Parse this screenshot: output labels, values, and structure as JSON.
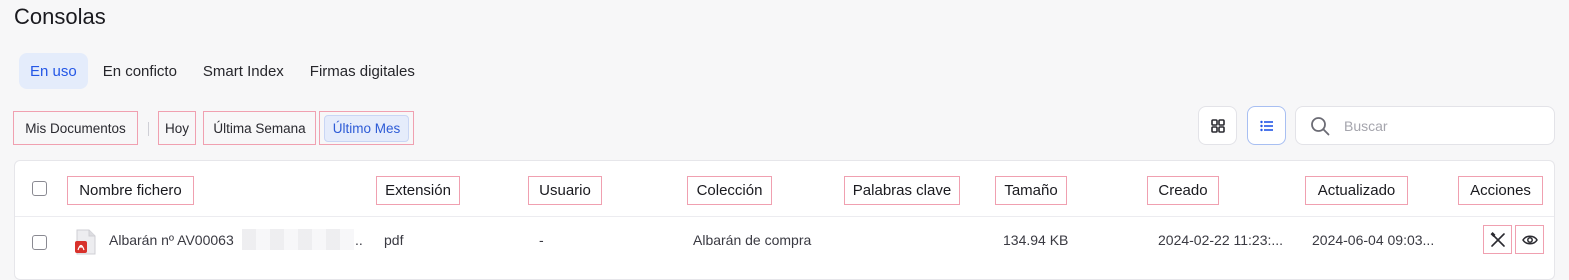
{
  "page": {
    "title": "Consolas"
  },
  "tabs": [
    {
      "label": "En uso",
      "active": true
    },
    {
      "label": "En conficto",
      "active": false
    },
    {
      "label": "Smart Index",
      "active": false
    },
    {
      "label": "Firmas digitales",
      "active": false
    }
  ],
  "filters": [
    {
      "label": "Mis Documentos",
      "selected": false
    },
    {
      "label": "Hoy",
      "selected": false
    },
    {
      "label": "Última Semana",
      "selected": false
    },
    {
      "label": "Último Mes",
      "selected": true
    }
  ],
  "search": {
    "placeholder": "Buscar",
    "value": ""
  },
  "view_buttons": {
    "grid_icon": "grid-icon",
    "list_icon": "list-icon",
    "active": "list"
  },
  "table": {
    "columns": [
      "Nombre fichero",
      "Extensión",
      "Usuario",
      "Colección",
      "Palabras clave",
      "Tamaño",
      "Creado",
      "Actualizado",
      "Acciones"
    ],
    "rows": [
      {
        "name": "Albarán nº AV00063",
        "name_suffix": "..",
        "extension": "pdf",
        "user": "-",
        "collection": "Albarán de compra",
        "keywords": "",
        "size": "134.94 KB",
        "created": "2024-02-22 11:23:...",
        "updated": "2024-06-04 09:03...",
        "file_icon": "pdf-file-icon",
        "actions": [
          "tools-icon",
          "eye-icon"
        ]
      }
    ]
  },
  "colors": {
    "accent": "#2457e6",
    "accent_bg": "#e4ecfb",
    "pdf_red": "#d8312b"
  }
}
